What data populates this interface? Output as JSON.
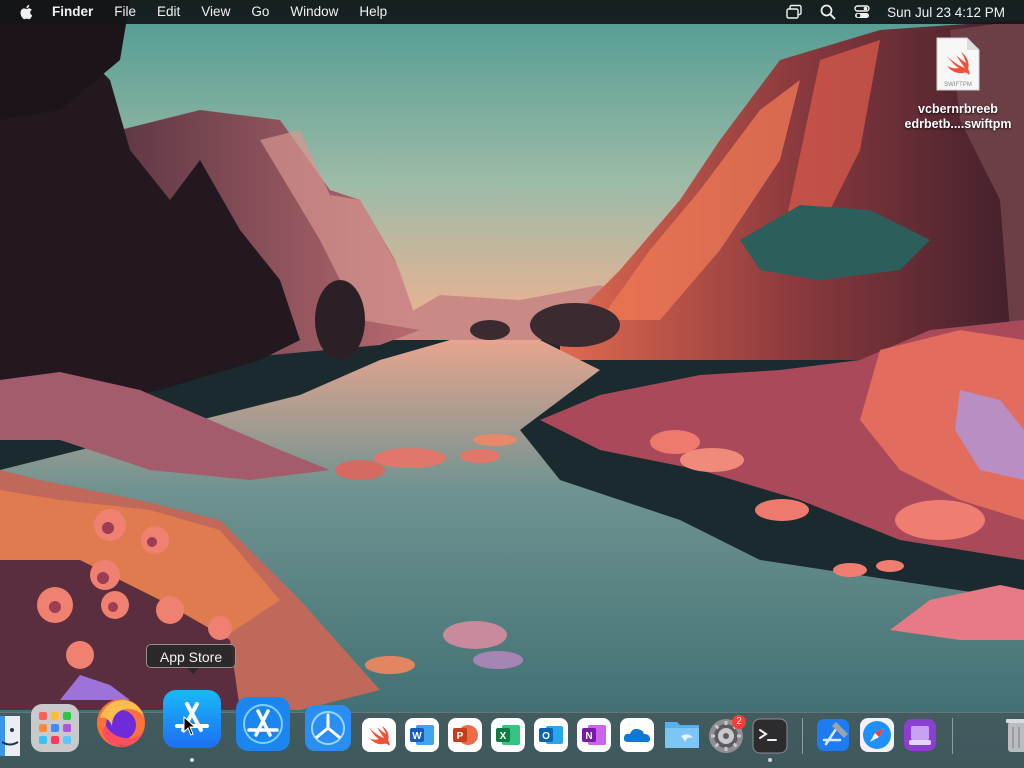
{
  "menubar": {
    "app_name": "Finder",
    "menus": [
      "File",
      "Edit",
      "View",
      "Go",
      "Window",
      "Help"
    ],
    "clock": "Sun Jul 23  4:12 PM",
    "status_icons": [
      "screen-mirroring-icon",
      "spotlight-search-icon",
      "control-center-icon"
    ]
  },
  "desktop_file": {
    "doc_label": "SWIFTPM",
    "name_line1": "vcbernrbreeb",
    "name_line2": "edrbetb....swiftpm"
  },
  "tooltip": {
    "text": "App Store"
  },
  "dock": {
    "items": [
      {
        "name": "finder",
        "icon": "finder-icon"
      },
      {
        "name": "launchpad",
        "icon": "launchpad-icon"
      },
      {
        "name": "firefox",
        "icon": "firefox-icon"
      },
      {
        "name": "app-store",
        "icon": "app-store-icon",
        "running": true
      },
      {
        "name": "app-store-2",
        "icon": "app-store-icon"
      },
      {
        "name": "testflight",
        "icon": "testflight-icon"
      },
      {
        "name": "swift-playgrounds",
        "icon": "swift-icon"
      },
      {
        "name": "word",
        "icon": "word-icon",
        "letter": "W"
      },
      {
        "name": "powerpoint",
        "icon": "powerpoint-icon",
        "letter": "P"
      },
      {
        "name": "excel",
        "icon": "excel-icon",
        "letter": "X"
      },
      {
        "name": "outlook",
        "icon": "outlook-icon",
        "letter": "O"
      },
      {
        "name": "onenote",
        "icon": "onenote-icon",
        "letter": "N"
      },
      {
        "name": "onedrive",
        "icon": "onedrive-icon"
      },
      {
        "name": "file-explorer",
        "icon": "folder-icon"
      },
      {
        "name": "system-settings",
        "icon": "gear-icon",
        "badge": "2"
      },
      {
        "name": "terminal",
        "icon": "terminal-icon",
        "running": true
      },
      {
        "name": "xcode",
        "icon": "xcode-icon"
      },
      {
        "name": "safari",
        "icon": "safari-icon"
      },
      {
        "name": "archive-utility",
        "icon": "archive-icon"
      },
      {
        "name": "trash",
        "icon": "trash-icon"
      }
    ]
  },
  "colors": {
    "sky_top": "#5fa59a",
    "sky_horizon": "#f3b392",
    "cliff_red": "#c6584d",
    "water": "#4a7f80",
    "dock_bg": "#464b4e"
  }
}
